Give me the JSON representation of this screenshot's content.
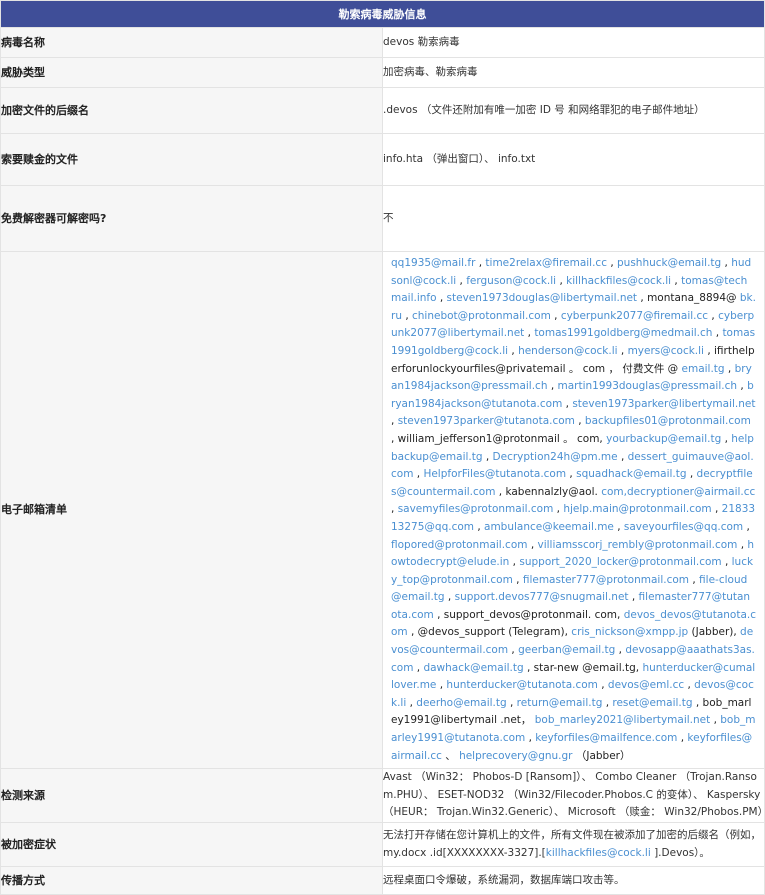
{
  "title": "勒索病毒威胁信息",
  "rows": [
    {
      "label": "病毒名称",
      "value": "devos 勒索病毒"
    },
    {
      "label": "威胁类型",
      "value": "加密病毒、勒索病毒"
    },
    {
      "label": "加密文件的后缀名",
      "value": ".devos （文件还附加有唯一加密 ID 号 和网络罪犯的电子邮件地址）"
    },
    {
      "label": "索要赎金的文件",
      "value": "info.hta （弹出窗口）、 info.txt"
    },
    {
      "label": "免费解密器可解密吗?",
      "value": "不"
    },
    {
      "label": "电子邮箱清单"
    },
    {
      "label": "检测来源",
      "value": "Avast （Win32： Phobos-D [Ransom]）、 Combo Cleaner （Trojan.Ransom.PHU）、 ESET-NOD32 （Win32/Filecoder.Phobos.C 的变体）、 Kaspersky （HEUR： Trojan.Win32.Generic）、 Microsoft （赎金： Win32/Phobos.PM）"
    },
    {
      "label": "被加密症状",
      "value_prefix": "无法打开存储在您计算机上的文件，所有文件现在被添加了加密的后缀名（例如， my.docx .id[XXXXXXXX-3327].[",
      "value_link": "killhackfiles@cock.li",
      "value_suffix": " ].Devos）。"
    },
    {
      "label": "传播方式",
      "value": "远程桌面口令爆破，系统漏洞，数据库端口攻击等。"
    }
  ],
  "emails": [
    {
      "t": "qq1935@mail.fr",
      "l": true
    },
    {
      "t": " , ",
      "l": false
    },
    {
      "t": "time2relax@firemail.cc",
      "l": true
    },
    {
      "t": " , ",
      "l": false
    },
    {
      "t": "pushhuck@email.tg",
      "l": true
    },
    {
      "t": " , ",
      "l": false
    },
    {
      "t": "hudsonl@cock.li",
      "l": true
    },
    {
      "t": " , ",
      "l": false
    },
    {
      "t": "ferguson@cock.li",
      "l": true
    },
    {
      "t": " , ",
      "l": false
    },
    {
      "t": "killhackfiles@cock.li",
      "l": true
    },
    {
      "t": " , ",
      "l": false
    },
    {
      "t": "tomas@techmail.info",
      "l": true
    },
    {
      "t": " , ",
      "l": false
    },
    {
      "t": "steven1973douglas@libertymail.net",
      "l": true
    },
    {
      "t": " , montana_8894@ ",
      "l": false
    },
    {
      "t": "bk.ru",
      "l": true
    },
    {
      "t": " , ",
      "l": false
    },
    {
      "t": "chinebot@protonmail.com",
      "l": true
    },
    {
      "t": " , ",
      "l": false
    },
    {
      "t": "cyberpunk2077@firemail.cc",
      "l": true
    },
    {
      "t": " , ",
      "l": false
    },
    {
      "t": "cyberpunk2077@libertymail.net",
      "l": true
    },
    {
      "t": " , ",
      "l": false
    },
    {
      "t": "tomas1991goldberg@medmail.ch",
      "l": true
    },
    {
      "t": " , ",
      "l": false
    },
    {
      "t": "tomas1991goldberg@cock.li",
      "l": true
    },
    {
      "t": " , ",
      "l": false
    },
    {
      "t": "henderson@cock.li",
      "l": true
    },
    {
      "t": " , ",
      "l": false
    },
    {
      "t": "myers@cock.li",
      "l": true
    },
    {
      "t": " , ifirthelperforunlockyourfiles@privatemail 。 com ， 付费文件 @ ",
      "l": false
    },
    {
      "t": "email.tg",
      "l": true
    },
    {
      "t": " , ",
      "l": false
    },
    {
      "t": "bryan1984jackson@pressmail.ch",
      "l": true
    },
    {
      "t": " , ",
      "l": false
    },
    {
      "t": "martin1993douglas@pressmail.ch",
      "l": true
    },
    {
      "t": " , ",
      "l": false
    },
    {
      "t": "bryan1984jackson@tutanota.com",
      "l": true
    },
    {
      "t": " , ",
      "l": false
    },
    {
      "t": "steven1973parker@libertymail.net",
      "l": true
    },
    {
      "t": " , ",
      "l": false
    },
    {
      "t": "steven1973parker@tutanota.com",
      "l": true
    },
    {
      "t": " , ",
      "l": false
    },
    {
      "t": "backupfiles01@protonmail.com",
      "l": true
    },
    {
      "t": " , william_jefferson1@protonmail 。 com, ",
      "l": false
    },
    {
      "t": "yourbackup@email.tg",
      "l": true
    },
    {
      "t": " , ",
      "l": false
    },
    {
      "t": "helpbackup@email.tg",
      "l": true
    },
    {
      "t": " , ",
      "l": false
    },
    {
      "t": "Decryption24h@pm.me",
      "l": true
    },
    {
      "t": " , ",
      "l": false
    },
    {
      "t": "dessert_guimauve@aol.com",
      "l": true
    },
    {
      "t": " , ",
      "l": false
    },
    {
      "t": "HelpforFiles@tutanota.com",
      "l": true
    },
    {
      "t": " , ",
      "l": false
    },
    {
      "t": "squadhack@email.tg",
      "l": true
    },
    {
      "t": " , ",
      "l": false
    },
    {
      "t": "decryptfiles@countermail.com",
      "l": true
    },
    {
      "t": " , kabennalzly@aol. ",
      "l": false
    },
    {
      "t": "com,decryptioner@airmail.cc",
      "l": true
    },
    {
      "t": " , ",
      "l": false
    },
    {
      "t": "savemyfiles@protonmail.com",
      "l": true
    },
    {
      "t": " , ",
      "l": false
    },
    {
      "t": "hjelp.main@protonmail.com",
      "l": true
    },
    {
      "t": " , ",
      "l": false
    },
    {
      "t": "2183313275@qq.com",
      "l": true
    },
    {
      "t": " , ",
      "l": false
    },
    {
      "t": "ambulance@keemail.me",
      "l": true
    },
    {
      "t": " , ",
      "l": false
    },
    {
      "t": "saveyourfiles@qq.com",
      "l": true
    },
    {
      "t": " , ",
      "l": false
    },
    {
      "t": "flopored@protonmail.com",
      "l": true
    },
    {
      "t": " , ",
      "l": false
    },
    {
      "t": "villiamsscorj_rembly@protonmail.com",
      "l": true
    },
    {
      "t": " , ",
      "l": false
    },
    {
      "t": "howtodecrypt@elude.in",
      "l": true
    },
    {
      "t": " , ",
      "l": false
    },
    {
      "t": "support_2020_locker@protonmail.com",
      "l": true
    },
    {
      "t": " , ",
      "l": false
    },
    {
      "t": "lucky_top@protonmail.com",
      "l": true
    },
    {
      "t": " , ",
      "l": false
    },
    {
      "t": "filemaster777@protonmail.com",
      "l": true
    },
    {
      "t": " , ",
      "l": false
    },
    {
      "t": "file-cloud@email.tg",
      "l": true
    },
    {
      "t": " , ",
      "l": false
    },
    {
      "t": "support.devos777@snugmail.net",
      "l": true
    },
    {
      "t": " , ",
      "l": false
    },
    {
      "t": "filemaster777@tutanota.com",
      "l": true
    },
    {
      "t": " , support_devos@protonmail. com, ",
      "l": false
    },
    {
      "t": "devos_devos@tutanota.com",
      "l": true
    },
    {
      "t": " , @devos_support (Telegram), ",
      "l": false
    },
    {
      "t": "cris_nickson@xmpp.jp",
      "l": true
    },
    {
      "t": " (Jabber), ",
      "l": false
    },
    {
      "t": "devos@countermail.com",
      "l": true
    },
    {
      "t": " , ",
      "l": false
    },
    {
      "t": "geerban@email.tg",
      "l": true
    },
    {
      "t": " , ",
      "l": false
    },
    {
      "t": "devosapp@aaathats3as.com",
      "l": true
    },
    {
      "t": " , ",
      "l": false
    },
    {
      "t": "dawhack@email.tg",
      "l": true
    },
    {
      "t": " , star-new @email.tg, ",
      "l": false
    },
    {
      "t": "hunterducker@cumallover.me",
      "l": true
    },
    {
      "t": " , ",
      "l": false
    },
    {
      "t": "hunterducker@tutanota.com",
      "l": true
    },
    {
      "t": " , ",
      "l": false
    },
    {
      "t": "devos@eml.cc",
      "l": true
    },
    {
      "t": " , ",
      "l": false
    },
    {
      "t": "devos@cock.li",
      "l": true
    },
    {
      "t": " , ",
      "l": false
    },
    {
      "t": "deerho@email.tg",
      "l": true
    },
    {
      "t": " , ",
      "l": false
    },
    {
      "t": "return@email.tg",
      "l": true
    },
    {
      "t": " , ",
      "l": false
    },
    {
      "t": "reset@email.tg",
      "l": true
    },
    {
      "t": " , bob_marley1991@libertymail .net， ",
      "l": false
    },
    {
      "t": "bob_marley2021@libertymail.net",
      "l": true
    },
    {
      "t": " , ",
      "l": false
    },
    {
      "t": "bob_marley1991@tutanota.com",
      "l": true
    },
    {
      "t": " , ",
      "l": false
    },
    {
      "t": "keyforfiles@mailfence.com",
      "l": true
    },
    {
      "t": " , ",
      "l": false
    },
    {
      "t": "keyforfiles@airmail.cc",
      "l": true
    },
    {
      "t": " 、 ",
      "l": false
    },
    {
      "t": "helprecovery@gnu.gr",
      "l": true
    },
    {
      "t": " （Jabber）",
      "l": false
    }
  ],
  "colors": {
    "header": "#3f4e98",
    "link": "#4a8fd1",
    "label_bg": "#f6f6f6",
    "border": "#e3e3e3"
  }
}
